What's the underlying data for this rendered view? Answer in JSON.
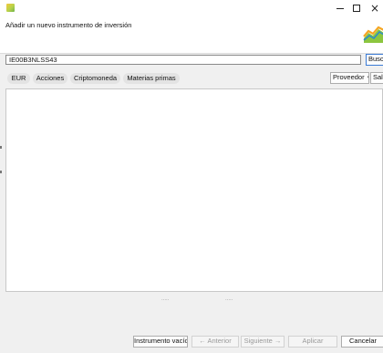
{
  "titlebar": {
    "controls": {
      "minimize": "minimize",
      "maximize": "maximize",
      "close": "close"
    }
  },
  "header": {
    "title": "Añadir un nuevo instrumento de inversión",
    "logo_icon": "chart-logo-icon"
  },
  "search": {
    "value": "IE00B3NLSS43",
    "button_label": "Buscar"
  },
  "filters": {
    "chips": [
      "EUR",
      "Acciones",
      "Criptomoneda",
      "Materias primas"
    ],
    "provider_label": "Proveedor",
    "provider_arrow": "▼",
    "exit_label": "Salir"
  },
  "splitter": {
    "dots": "....."
  },
  "footer": {
    "empty_instrument": "Instrumento vacío",
    "previous": "← Anterior",
    "next": "Siguiente →",
    "apply": "Aplicar",
    "cancel": "Cancelar"
  },
  "colors": {
    "focus_border": "#3a7bd5",
    "disabled_text": "#9a9a9a",
    "chip_bg": "#e3e3e3"
  }
}
